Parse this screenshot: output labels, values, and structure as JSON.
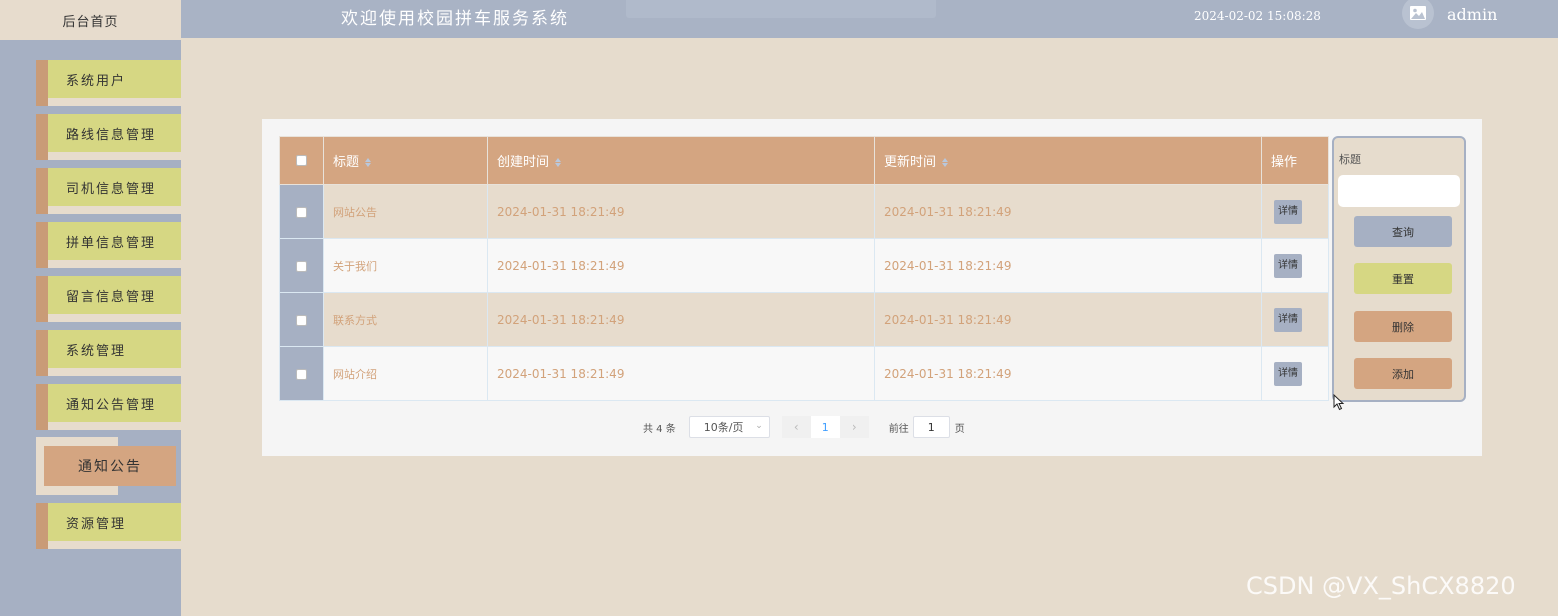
{
  "sidebar": {
    "home": "后台首页",
    "items": [
      {
        "label": "系统用户"
      },
      {
        "label": "路线信息管理"
      },
      {
        "label": "司机信息管理"
      },
      {
        "label": "拼单信息管理"
      },
      {
        "label": "留言信息管理"
      },
      {
        "label": "系统管理"
      },
      {
        "label": "通知公告管理"
      }
    ],
    "active": {
      "label": "通知公告"
    },
    "last": {
      "label": "资源管理"
    }
  },
  "header": {
    "title": "欢迎使用校园拼车服务系统",
    "datetime": "2024-02-02 15:08:28",
    "user": "admin",
    "avatar_icon": "image-icon"
  },
  "table": {
    "columns": [
      "标题",
      "创建时间",
      "更新时间",
      "操作"
    ],
    "rows": [
      {
        "title": "网站公告",
        "created": "2024-01-31 18:21:49",
        "updated": "2024-01-31 18:21:49",
        "action": "详情"
      },
      {
        "title": "关于我们",
        "created": "2024-01-31 18:21:49",
        "updated": "2024-01-31 18:21:49",
        "action": "详情"
      },
      {
        "title": "联系方式",
        "created": "2024-01-31 18:21:49",
        "updated": "2024-01-31 18:21:49",
        "action": "详情"
      },
      {
        "title": "网站介绍",
        "created": "2024-01-31 18:21:49",
        "updated": "2024-01-31 18:21:49",
        "action": "详情"
      }
    ]
  },
  "search": {
    "label": "标题",
    "value": "",
    "query_label": "查询",
    "reset_label": "重置",
    "delete_label": "删除",
    "add_label": "添加"
  },
  "pagination": {
    "total_text": "共 4 条",
    "page_size": "10条/页",
    "current_page": "1",
    "goto_label": "前往",
    "goto_value": "1",
    "page_unit": "页"
  },
  "colors": {
    "sidebar": "#a6b0c3",
    "menu": "#d6d783",
    "accent": "#d4a581",
    "page_bg": "#e6dccd"
  },
  "watermark": "CSDN @VX_ShCX8820"
}
